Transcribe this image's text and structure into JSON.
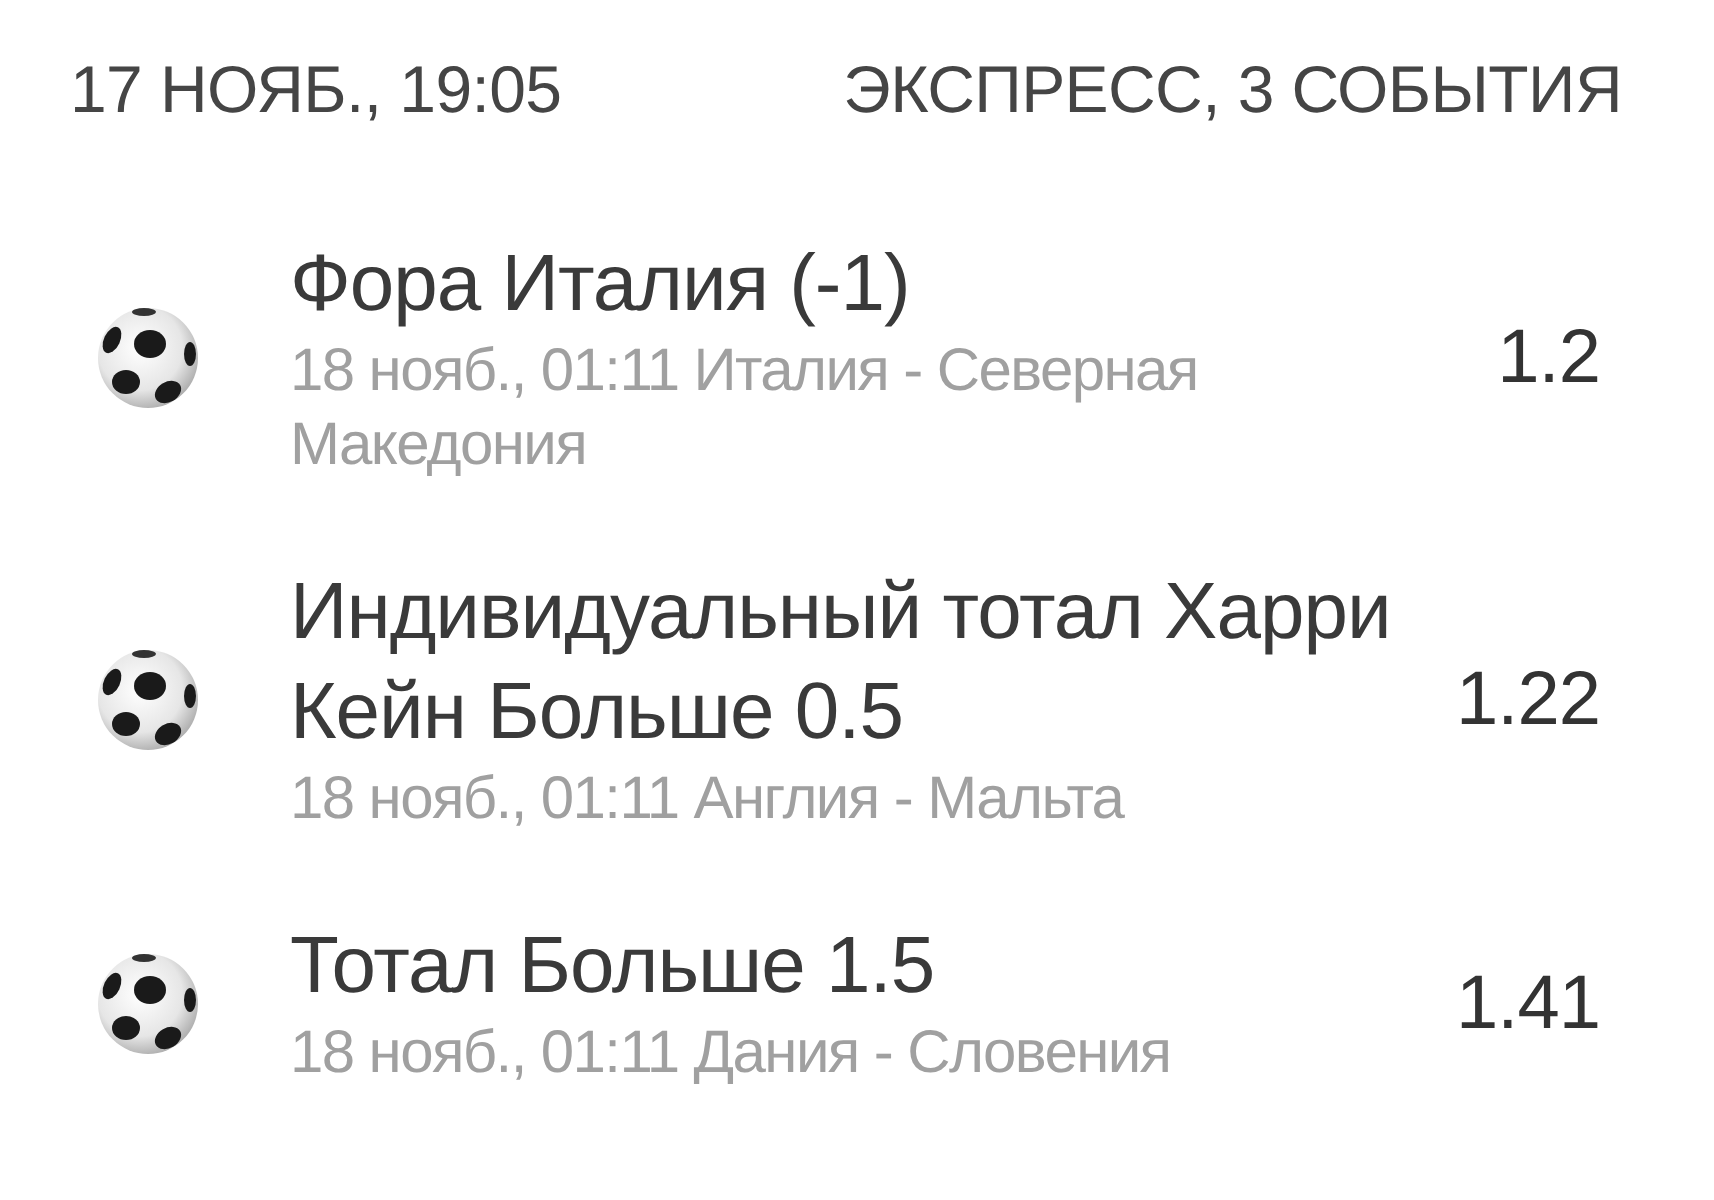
{
  "header": {
    "date": "17 НОЯБ., 19:05",
    "summary": "ЭКСПРЕСС, 3 СОБЫТИЯ"
  },
  "events": [
    {
      "market": "Фора Италия (-1)",
      "details": "18 нояб., 01:11 Италия - Северная Македония",
      "odds": "1.2"
    },
    {
      "market": "Индивидуальный тотал Харри Кейн Больше 0.5",
      "details": "18 нояб., 01:11 Англия - Мальта",
      "odds": "1.22"
    },
    {
      "market": "Тотал Больше 1.5",
      "details": "18 нояб., 01:11 Дания - Словения",
      "odds": "1.41"
    }
  ]
}
